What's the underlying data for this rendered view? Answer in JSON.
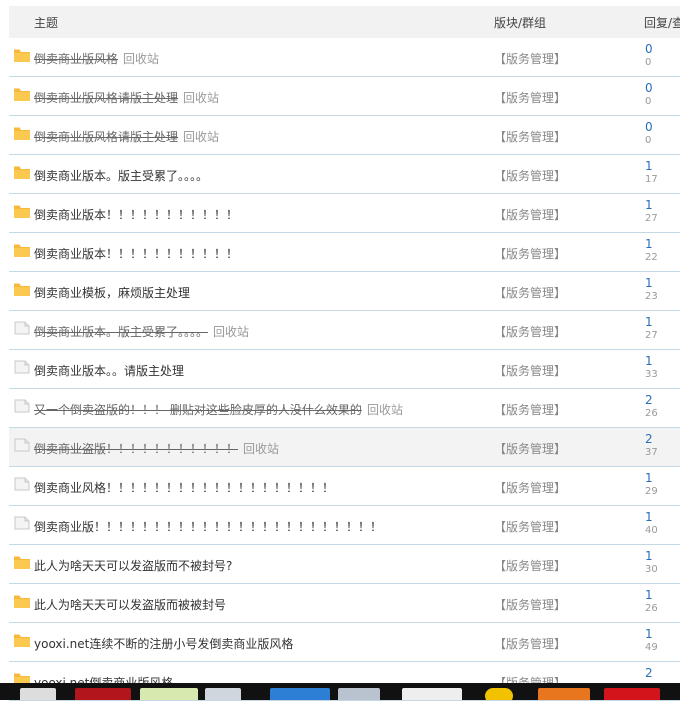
{
  "header": {
    "col_topic": "主题",
    "col_forum": "版块/群组",
    "col_stats": "回复/查"
  },
  "recycle_label": "回收站",
  "forum_label": "【版务管理】",
  "rows": [
    {
      "title": "倒卖商业版风格",
      "struck": true,
      "recycle": true,
      "icon": "folder",
      "replies": "0",
      "views": "0"
    },
    {
      "title": "倒卖商业版风格请版主处理",
      "struck": true,
      "recycle": true,
      "icon": "folder",
      "replies": "0",
      "views": "0"
    },
    {
      "title": "倒卖商业版风格请版主处理",
      "struck": true,
      "recycle": true,
      "icon": "folder",
      "replies": "0",
      "views": "0"
    },
    {
      "title": "倒卖商业版本。版主受累了。。。。",
      "struck": false,
      "recycle": false,
      "icon": "folder",
      "replies": "1",
      "views": "17"
    },
    {
      "title": "倒卖商业版本！！！！！！！！！！！",
      "struck": false,
      "recycle": false,
      "icon": "folder",
      "replies": "1",
      "views": "27"
    },
    {
      "title": "倒卖商业版本！！！！！！！！！！！",
      "struck": false,
      "recycle": false,
      "icon": "folder",
      "replies": "1",
      "views": "22"
    },
    {
      "title": "倒卖商业模板，麻烦版主处理",
      "struck": false,
      "recycle": false,
      "icon": "folder",
      "replies": "1",
      "views": "23"
    },
    {
      "title": "倒卖商业版本。版主受累了。。。。",
      "struck": true,
      "recycle": true,
      "icon": "doc",
      "replies": "1",
      "views": "27"
    },
    {
      "title": "倒卖商业版本。。请版主处理",
      "struck": false,
      "recycle": false,
      "icon": "doc",
      "replies": "1",
      "views": "33"
    },
    {
      "title": "又一个倒卖盗版的！！！ 删贴对这些脸皮厚的人没什么效果的",
      "struck": true,
      "recycle": true,
      "icon": "doc",
      "replies": "2",
      "views": "26"
    },
    {
      "title": "倒卖商业盗版！！！！！！！！！！！",
      "struck": true,
      "recycle": true,
      "icon": "doc",
      "replies": "2",
      "views": "37",
      "highlight": true
    },
    {
      "title": "倒卖商业风格！！！！！！！！！！！！！！！！！！！",
      "struck": false,
      "recycle": false,
      "icon": "doc",
      "replies": "1",
      "views": "29"
    },
    {
      "title": "倒卖商业版！！！！！！！！！！！！！！！！！！！！！！！！",
      "struck": false,
      "recycle": false,
      "icon": "doc",
      "replies": "1",
      "views": "40"
    },
    {
      "title": "此人为啥天天可以发盗版而不被封号?",
      "struck": false,
      "recycle": false,
      "icon": "folder",
      "replies": "1",
      "views": "30"
    },
    {
      "title": "此人为啥天天可以发盗版而被被封号",
      "struck": false,
      "recycle": false,
      "icon": "folder",
      "replies": "1",
      "views": "26"
    },
    {
      "title": "yooxi.net连续不断的注册小号发倒卖商业版风格",
      "struck": false,
      "recycle": false,
      "icon": "folder",
      "replies": "1",
      "views": "49"
    },
    {
      "title": "yooxi.net倒卖商业版风格",
      "struck": false,
      "recycle": false,
      "icon": "folder",
      "replies": "2",
      "views": ""
    }
  ],
  "colors": {
    "link": "#2a6ebb",
    "folder": "#f6b93b",
    "border": "#c4d8e6"
  }
}
